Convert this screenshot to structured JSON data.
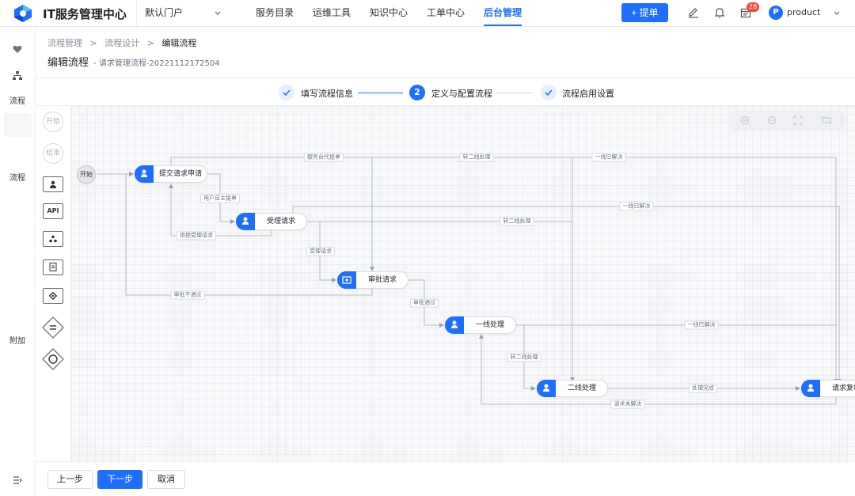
{
  "header": {
    "app_title": "IT服务管理中心",
    "portal": "默认门户",
    "nav": [
      {
        "label": "服务目录",
        "active": false
      },
      {
        "label": "运维工具",
        "active": false
      },
      {
        "label": "知识中心",
        "active": false
      },
      {
        "label": "工单中心",
        "active": false
      },
      {
        "label": "后台管理",
        "active": true
      }
    ],
    "submit_label": "+ 提单",
    "notification_badge": "28",
    "avatar_letter": "P",
    "user_name": "product",
    "icons": [
      "edit-icon",
      "bell-icon",
      "calendar-icon"
    ]
  },
  "rail": {
    "label_process_1": "流程",
    "label_process_2": "流程",
    "label_addon": "附加"
  },
  "breadcrumb": {
    "items": [
      "流程管理",
      "流程设计",
      "编辑流程"
    ],
    "separator": ">"
  },
  "title": {
    "main": "编辑流程",
    "sub": "- 请求管理流程-20221112172504"
  },
  "steps": [
    {
      "label": "填写流程信息",
      "state": "done"
    },
    {
      "label": "定义与配置流程",
      "state": "current",
      "number": "2"
    },
    {
      "label": "流程启用设置",
      "state": "done"
    }
  ],
  "palette": {
    "start": "开始",
    "end": "结束",
    "api": "API"
  },
  "canvas": {
    "start_node": "开始",
    "nodes": {
      "submit": "提交请求申请",
      "accept": "受理请求",
      "approve": "审批请求",
      "l1": "一线处理",
      "l2": "二线处理",
      "review": "请求复核"
    },
    "edge_labels": {
      "proxy": "服务台代提单",
      "to_l2_top": "转二线处理",
      "l1_solved_top": "一线已解决",
      "self_submit": "用户自主提单",
      "l1_solved_mid": "一线已解决",
      "to_l2_mid": "转二线处理",
      "reject_accept": "拒绝受理请求",
      "accept_req": "受理请求",
      "not_approved": "审批不通过",
      "approved": "审批通过",
      "l1_solved_low": "一线已解决",
      "to_l2_low": "转二线处理",
      "done": "处理完成",
      "unsolved": "请求未解决"
    }
  },
  "footer": {
    "prev": "上一步",
    "next": "下一步",
    "cancel": "取消"
  },
  "colors": {
    "accent": "#1e6fff",
    "badge": "#f5483b"
  }
}
